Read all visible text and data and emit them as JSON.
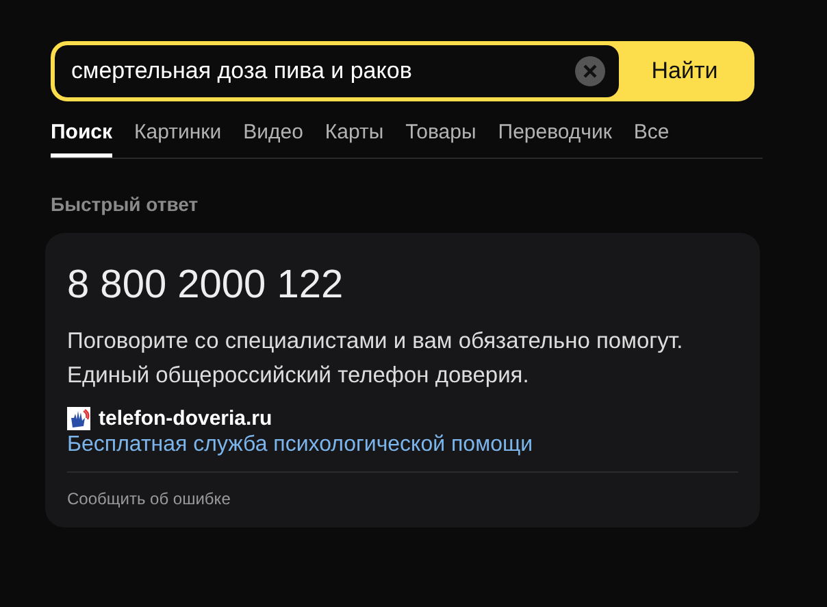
{
  "search": {
    "value": "смертельная доза пива и раков",
    "button": "Найти"
  },
  "tabs": [
    {
      "label": "Поиск",
      "selected": true
    },
    {
      "label": "Картинки",
      "selected": false
    },
    {
      "label": "Видео",
      "selected": false
    },
    {
      "label": "Карты",
      "selected": false
    },
    {
      "label": "Товары",
      "selected": false
    },
    {
      "label": "Переводчик",
      "selected": false
    },
    {
      "label": "Все",
      "selected": false
    }
  ],
  "quick_answer": {
    "heading": "Быстрый ответ",
    "phone": "8 800 2000 122",
    "text": "Поговорите со специалистами и вам обязательно помогут. Единый общероссийский телефон доверия.",
    "site": "telefon-doveria.ru",
    "link": "Бесплатная служба психологической помощи",
    "report": "Сообщить об ошибке"
  }
}
